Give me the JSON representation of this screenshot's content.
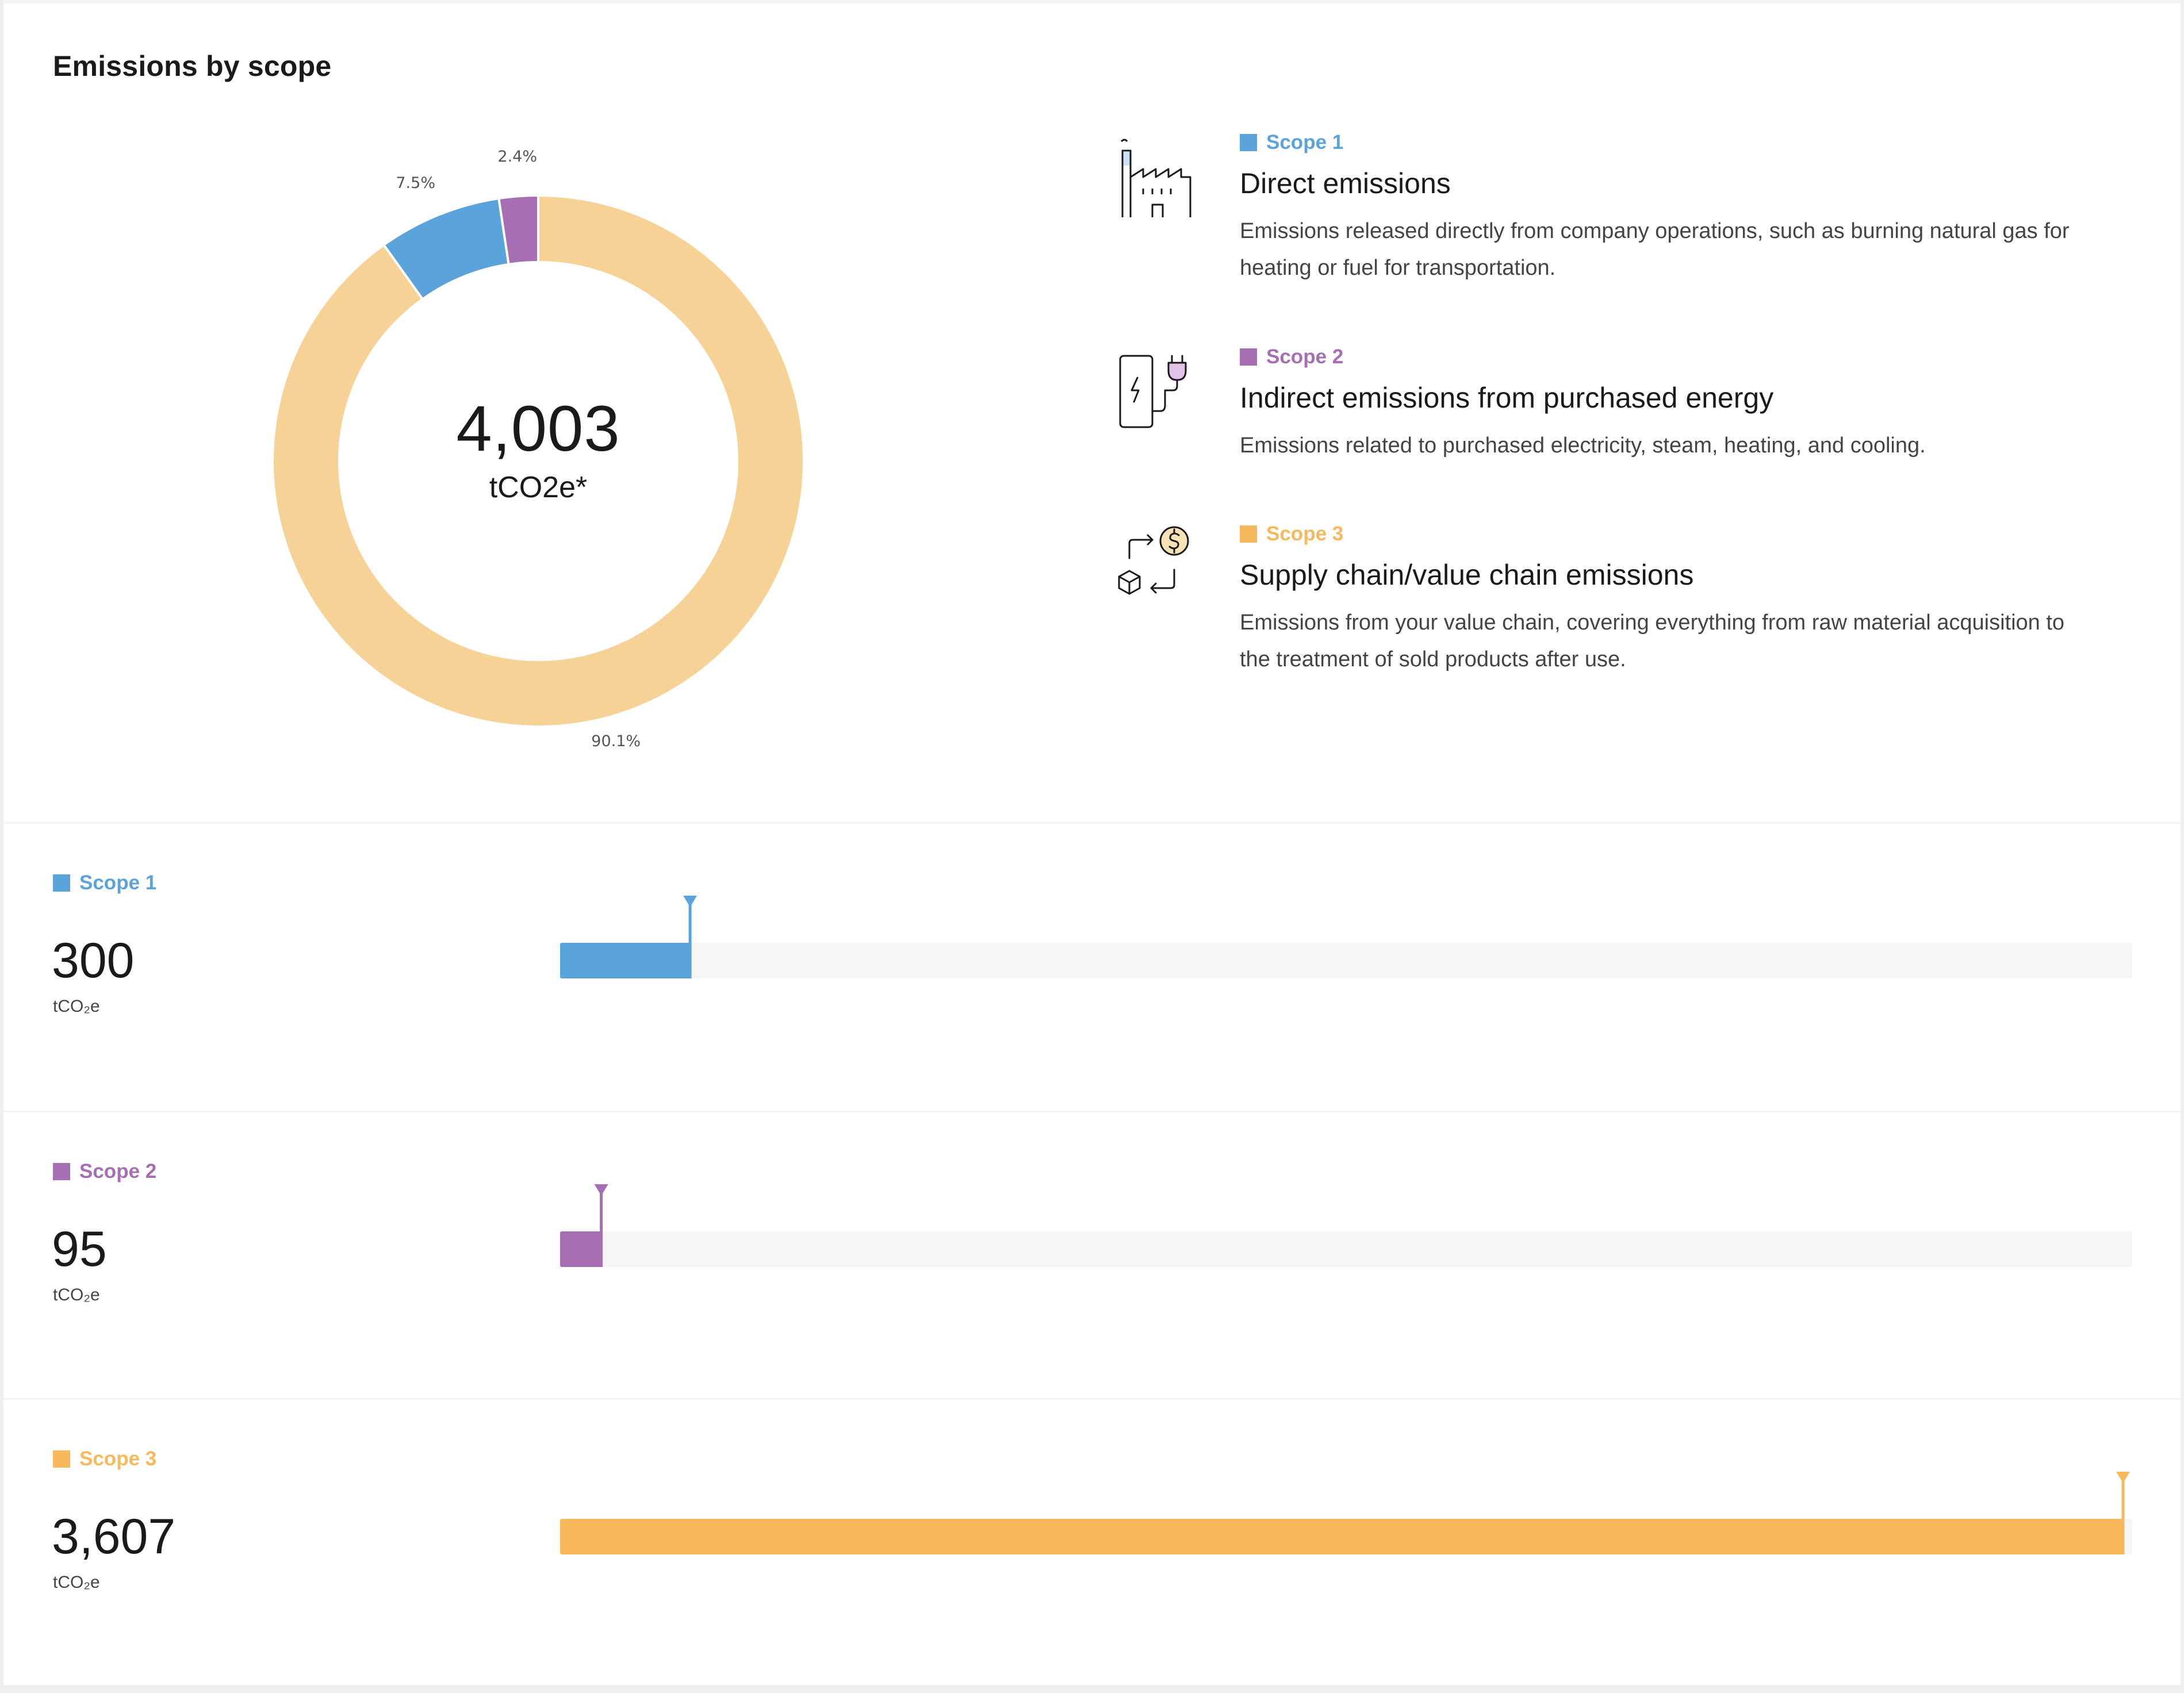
{
  "title": "Emissions by scope",
  "chart_data": {
    "type": "pie",
    "total": "4,003",
    "total_unit": "tCO2e*",
    "slices": [
      {
        "label": "Scope 1",
        "value": 300,
        "percent_label": "7.5%",
        "color": "#5aa4db"
      },
      {
        "label": "Scope 2",
        "value": 95,
        "percent_label": "2.4%",
        "color": "#a76fb3"
      },
      {
        "label": "Scope 3",
        "value": 3607,
        "percent_label": "90.1%",
        "color": "#f6d296"
      }
    ]
  },
  "legend": [
    {
      "tag": "Scope 1",
      "color": "#5aa4db",
      "heading": "Direct emissions",
      "description": "Emissions released directly from company operations, such as burning natural gas for heating or fuel for transportation.",
      "icon": "factory-icon"
    },
    {
      "tag": "Scope 2",
      "color": "#a76fb3",
      "heading": "Indirect emissions from purchased energy",
      "description": "Emissions related to purchased electricity, steam, heating, and cooling.",
      "icon": "charging-station-icon"
    },
    {
      "tag": "Scope 3",
      "color": "#f6b95d",
      "heading": "Supply chain/value chain emissions",
      "description": "Emissions from your value chain, covering everything from raw material acquisition to the treatment of sold products after use.",
      "icon": "supply-chain-icon"
    }
  ],
  "bars": [
    {
      "tag": "Scope 1",
      "value_label": "300",
      "value": 300,
      "unit": "tCO₂e",
      "color": "#5aa4db"
    },
    {
      "tag": "Scope 2",
      "value_label": "95",
      "value": 95,
      "unit": "tCO₂e",
      "color": "#a76fb3"
    },
    {
      "tag": "Scope 3",
      "value_label": "3,607",
      "value": 3607,
      "unit": "tCO₂e",
      "color": "#f8b95d"
    }
  ],
  "bar_max": 3607,
  "track_color": "#f4f5f4"
}
